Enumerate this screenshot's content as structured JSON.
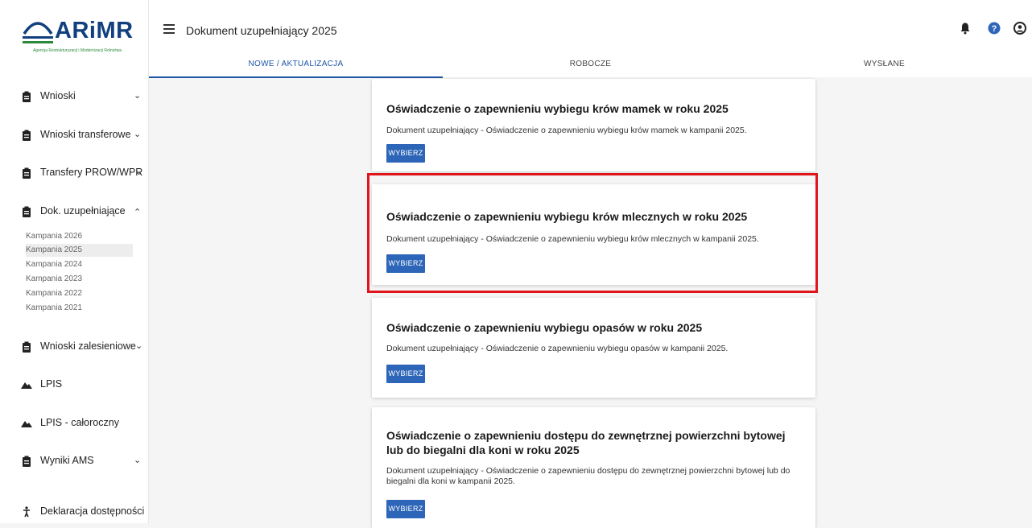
{
  "logo": {
    "title": "ARiMR",
    "subtitle": "Agencja Restrukturyzacji i Modernizacji Rolnictwa"
  },
  "header": {
    "title": "Dokument uzupełniający 2025",
    "icons": [
      "bell-icon",
      "help-icon",
      "user-icon"
    ]
  },
  "tabs": [
    {
      "label": "NOWE / AKTUALIZACJA",
      "active": true
    },
    {
      "label": "ROBOCZE",
      "active": false
    },
    {
      "label": "WYSŁANE",
      "active": false
    }
  ],
  "sidebar": {
    "items": [
      {
        "label": "Wnioski",
        "icon": "clipboard-icon",
        "chevron": "down"
      },
      {
        "label": "Wnioski transferowe",
        "icon": "clipboard-icon",
        "chevron": "down"
      },
      {
        "label": "Transfery PROW/WPR",
        "icon": "clipboard-icon",
        "chevron": "down"
      },
      {
        "label": "Dok. uzupełniające",
        "icon": "clipboard-icon",
        "chevron": "up"
      },
      {
        "label": "Wnioski zalesieniowe",
        "icon": "clipboard-icon",
        "chevron": "down"
      },
      {
        "label": "LPIS",
        "icon": "mountain-icon",
        "chevron": ""
      },
      {
        "label": "LPIS - całoroczny",
        "icon": "mountain-icon",
        "chevron": ""
      },
      {
        "label": "Wyniki AMS",
        "icon": "clipboard-icon",
        "chevron": "down"
      },
      {
        "label": "Deklaracja dostępności",
        "icon": "accessibility-icon",
        "chevron": ""
      }
    ],
    "subitems": [
      {
        "label": "Kampania 2026",
        "selected": false
      },
      {
        "label": "Kampania 2025",
        "selected": true
      },
      {
        "label": "Kampania 2024",
        "selected": false
      },
      {
        "label": "Kampania 2023",
        "selected": false
      },
      {
        "label": "Kampania 2022",
        "selected": false
      },
      {
        "label": "Kampania 2021",
        "selected": false
      }
    ]
  },
  "cards": [
    {
      "title": "Oświadczenie o zapewnieniu wybiegu krów mamek w roku 2025",
      "description": "Dokument uzupełniający - Oświadczenie o zapewnieniu wybiegu krów mamek w kampanii 2025.",
      "button": "WYBIERZ"
    },
    {
      "title": "Oświadczenie o zapewnieniu wybiegu krów mlecznych w roku 2025",
      "description": "Dokument uzupełniający - Oświadczenie o zapewnieniu wybiegu krów mlecznych w kampanii 2025.",
      "button": "WYBIERZ",
      "highlighted": true
    },
    {
      "title": "Oświadczenie o zapewnieniu wybiegu opasów w roku 2025",
      "description": "Dokument uzupełniający - Oświadczenie o zapewnieniu wybiegu opasów w kampanii 2025.",
      "button": "WYBIERZ"
    },
    {
      "title": "Oświadczenie o zapewnieniu dostępu do zewnętrznej powierzchni bytowej lub do biegalni dla koni w roku 2025",
      "description": "Dokument uzupełniający - Oświadczenie o zapewnieniu dostępu do zewnętrznej powierzchni bytowej lub do biegalni dla koni w kampanii 2025.",
      "button": "WYBIERZ"
    }
  ],
  "colors": {
    "accent": "#2d66b8",
    "brand": "#12407e",
    "highlight": "#e0151b"
  }
}
